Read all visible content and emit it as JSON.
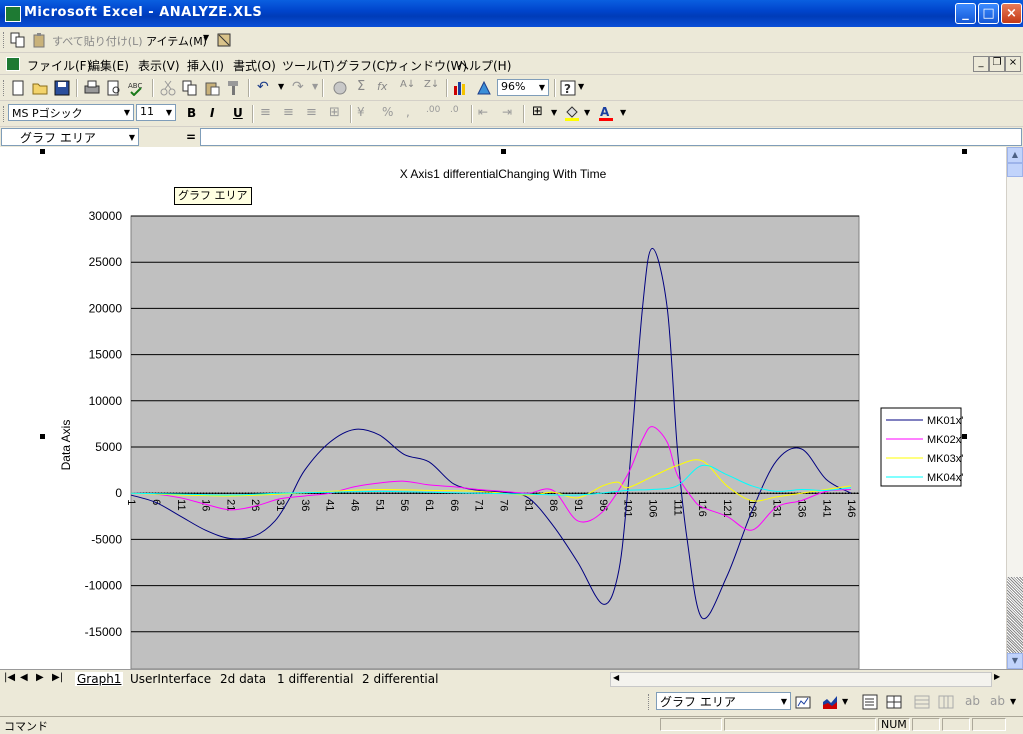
{
  "window": {
    "title": "Microsoft Excel - ANALYZE.XLS"
  },
  "toolbar_paste": {
    "paste_all": "すべて貼り付け(L)",
    "items": "アイテム(M)"
  },
  "menu": [
    "ファイル(F)",
    "編集(E)",
    "表示(V)",
    "挿入(I)",
    "書式(O)",
    "ツール(T)",
    "グラフ(C)",
    "ウィンドウ(W)",
    "ヘルプ(H)"
  ],
  "standard": {
    "zoom": "96%"
  },
  "formatting": {
    "font": "MS Pゴシック",
    "size": "11"
  },
  "formula_bar": {
    "name_box": "グラフ エリア",
    "equals": "="
  },
  "tooltip": "グラフ エリア",
  "chart_data": {
    "type": "line",
    "title": "X Axis1 differentialChanging With Time",
    "ylabel": "Data Axis",
    "xlabel": "",
    "ylim": [
      -15000,
      30000
    ],
    "yticks": [
      "30000",
      "25000",
      "20000",
      "15000",
      "10000",
      "5000",
      "0",
      "-5000",
      "-10000",
      "-15000"
    ],
    "xticks": [
      "1",
      "6",
      "11",
      "16",
      "21",
      "26",
      "31",
      "36",
      "41",
      "46",
      "51",
      "56",
      "61",
      "66",
      "71",
      "76",
      "81",
      "86",
      "91",
      "96",
      "101",
      "106",
      "111",
      "116",
      "121",
      "126",
      "131",
      "136",
      "141",
      "146"
    ],
    "grid": true,
    "legend": "right",
    "series": [
      {
        "name": "MK01x'",
        "color": "#000080",
        "x": [
          1,
          6,
          11,
          16,
          21,
          26,
          30,
          33,
          36,
          41,
          46,
          51,
          56,
          61,
          66,
          71,
          76,
          81,
          86,
          91,
          96,
          99,
          101,
          104,
          106,
          109,
          111,
          113,
          116,
          121,
          126,
          131,
          136,
          141,
          146
        ],
        "y": [
          -200,
          -1000,
          -2500,
          -4000,
          -4900,
          -4600,
          -3000,
          -500,
          2500,
          5500,
          6900,
          6300,
          4200,
          3400,
          1000,
          300,
          100,
          -500,
          -3500,
          -7500,
          -12000,
          -9000,
          0,
          20000,
          26500,
          20000,
          5000,
          -5000,
          -13500,
          -9000,
          -2000,
          3500,
          4800,
          1500,
          0
        ]
      },
      {
        "name": "MK02x'",
        "color": "#ff00ff",
        "x": [
          1,
          6,
          11,
          16,
          21,
          26,
          31,
          36,
          41,
          46,
          51,
          56,
          61,
          66,
          71,
          76,
          81,
          86,
          91,
          96,
          101,
          104,
          106,
          109,
          111,
          114,
          116,
          121,
          126,
          131,
          136,
          141,
          146
        ],
        "y": [
          0,
          -100,
          -500,
          -1200,
          -1800,
          -1400,
          -600,
          -300,
          0,
          700,
          1100,
          1300,
          900,
          700,
          400,
          200,
          0,
          300,
          -3000,
          -2000,
          2000,
          5800,
          7200,
          5500,
          2000,
          -500,
          -1500,
          -2500,
          -4000,
          -1500,
          -800,
          200,
          400
        ]
      },
      {
        "name": "MK03x'",
        "color": "#ffff00",
        "x": [
          1,
          11,
          21,
          31,
          41,
          51,
          61,
          71,
          81,
          86,
          91,
          96,
          99,
          101,
          106,
          111,
          116,
          121,
          126,
          131,
          136,
          141,
          146
        ],
        "y": [
          0,
          -200,
          -300,
          -100,
          200,
          400,
          300,
          200,
          -200,
          100,
          -500,
          800,
          1200,
          600,
          1800,
          3000,
          3500,
          800,
          -800,
          -400,
          0,
          400,
          800
        ]
      },
      {
        "name": "MK04x'",
        "color": "#00ffff",
        "x": [
          1,
          11,
          21,
          31,
          41,
          51,
          61,
          71,
          81,
          91,
          101,
          106,
          111,
          116,
          121,
          126,
          131,
          136,
          141,
          146
        ],
        "y": [
          0,
          -100,
          -200,
          0,
          100,
          200,
          100,
          0,
          -100,
          -200,
          300,
          400,
          800,
          3000,
          2000,
          800,
          200,
          400,
          300,
          600
        ]
      }
    ]
  },
  "sheet_tabs": [
    "Graph1",
    "UserInterface",
    "2d data",
    "1 differential",
    "2 differential"
  ],
  "drawing": {
    "object_box": "グラフ エリア"
  },
  "status": {
    "left": "コマンド",
    "num": "NUM"
  }
}
